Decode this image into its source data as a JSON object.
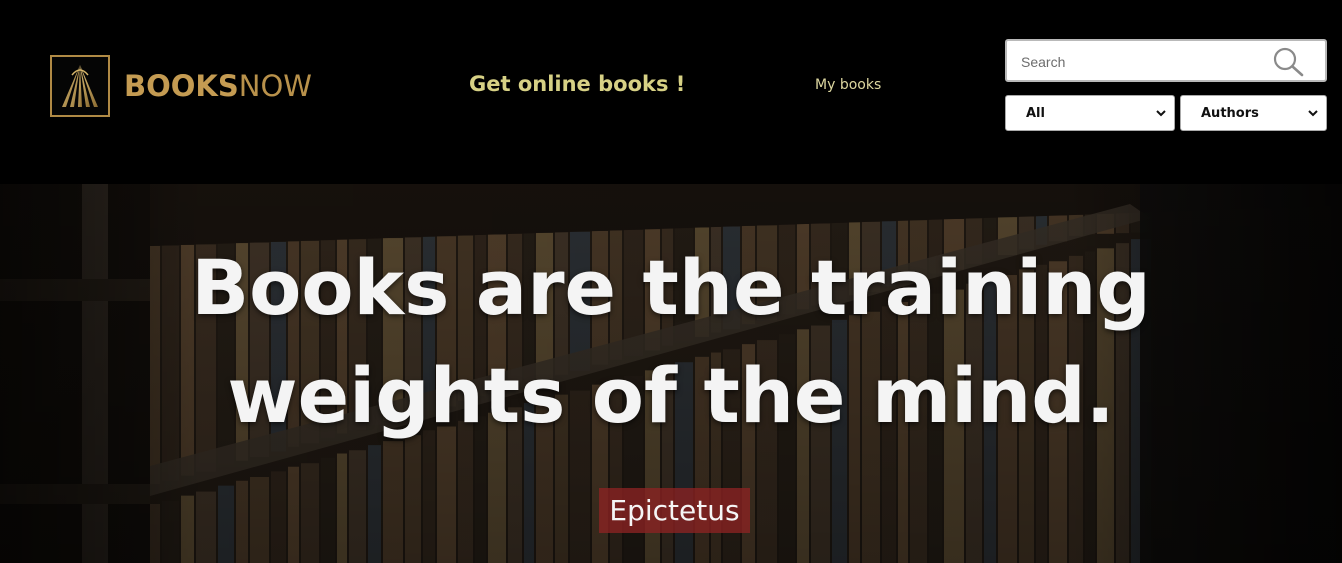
{
  "header": {
    "logo": {
      "word1": "BOOKS",
      "word2": "NOW"
    },
    "tagline": "Get online books !",
    "nav_link": "My books",
    "search": {
      "placeholder": "Search",
      "value": ""
    },
    "filter_category": {
      "selected": "All"
    },
    "filter_type": {
      "selected": "Authors"
    }
  },
  "hero": {
    "quote_line1": "Books are the training",
    "quote_line2": "weights of the mind.",
    "author": "Epictetus"
  },
  "colors": {
    "brand_gold": "#c49b52",
    "tagline": "#d7d185",
    "author_tag": "#8c2222"
  },
  "icons": {
    "search": "magnifier-icon",
    "chevron": "chevron-down-icon",
    "logo": "book-fan-icon"
  }
}
